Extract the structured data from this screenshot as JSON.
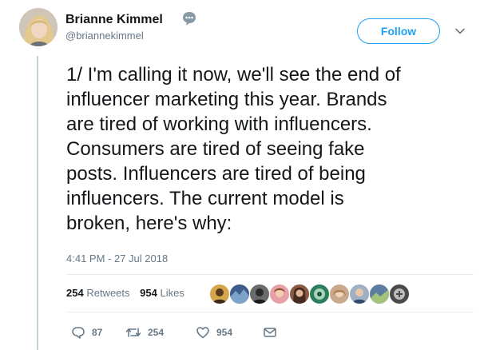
{
  "author": {
    "name": "Brianne Kimmel",
    "handle": "@briannekimmel"
  },
  "follow_button": {
    "label": "Follow"
  },
  "tweet": {
    "text": "1/ I'm calling it now, we'll see the end of\ninfluencer marketing this year. Brands\nare tired of working with influencers.\nConsumers are tired of seeing fake\nposts. Influencers are tired of being\ninfluencers. The current model is\nbroken, here's why:",
    "timestamp": "4:41 PM - 27 Jul 2018"
  },
  "stats": {
    "retweets_count": "254",
    "retweets_label": "Retweets",
    "likes_count": "954",
    "likes_label": "Likes"
  },
  "likers": [
    {
      "icon": "liker-avatar"
    },
    {
      "icon": "liker-avatar"
    },
    {
      "icon": "liker-avatar"
    },
    {
      "icon": "liker-avatar"
    },
    {
      "icon": "liker-avatar"
    },
    {
      "icon": "liker-avatar"
    },
    {
      "icon": "liker-avatar"
    },
    {
      "icon": "liker-avatar"
    },
    {
      "icon": "liker-avatar"
    },
    {
      "icon": "liker-avatar"
    }
  ],
  "actions": {
    "reply_count": "87",
    "retweet_count": "254",
    "like_count": "954"
  },
  "colors": {
    "accent": "#1da1f2",
    "text": "#14171a",
    "secondary": "#657786",
    "thread_line": "#c4cfd6",
    "divider": "#e6ecf0"
  }
}
